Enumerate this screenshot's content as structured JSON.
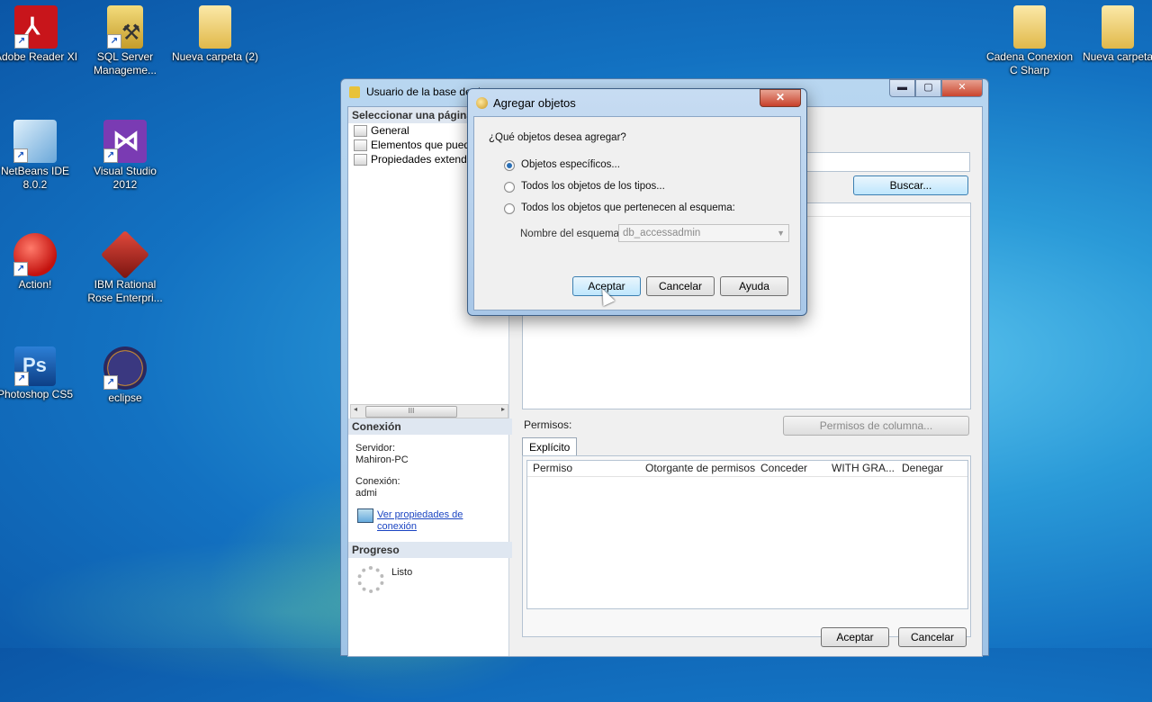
{
  "desktop": {
    "icons": [
      {
        "label1": "Adobe Reader XI",
        "label2": "",
        "icon": "adobe-reader-icon",
        "color": "#c8151b"
      },
      {
        "label1": "SQL Server",
        "label2": "Manageme...",
        "icon": "sql-server-icon",
        "color": "#d9b53a"
      },
      {
        "label1": "Nueva carpeta (2)",
        "label2": "",
        "icon": "folder-icon",
        "color": "#f1d27a"
      },
      {
        "label1": "NetBeans IDE",
        "label2": "8.0.2",
        "icon": "netbeans-icon",
        "color": "#7fb6e6"
      },
      {
        "label1": "Visual Studio",
        "label2": "2012",
        "icon": "visual-studio-icon",
        "color": "#7a3bb3"
      },
      {
        "label1": "Action!",
        "label2": "",
        "icon": "action-icon",
        "color": "#d42a22"
      },
      {
        "label1": "IBM Rational",
        "label2": "Rose Enterpri...",
        "icon": "ibm-rational-icon",
        "color": "#a8241c"
      },
      {
        "label1": "Photoshop CS5",
        "label2": "",
        "icon": "photoshop-icon",
        "color": "#1b64b8"
      },
      {
        "label1": "eclipse",
        "label2": "",
        "icon": "eclipse-icon",
        "color": "#2c2a6a"
      },
      {
        "label1": "Cadena Conexion",
        "label2": "C Sharp",
        "icon": "folder-icon",
        "color": "#f1d27a"
      },
      {
        "label1": "Nueva carpeta",
        "label2": "",
        "icon": "folder-icon",
        "color": "#f1d27a"
      }
    ]
  },
  "main_window": {
    "title": "Usuario de la base de d",
    "min": "▬",
    "max": "▢",
    "close": "✕",
    "left_header": "Seleccionar una página",
    "pages": [
      "General",
      "Elementos que pueden",
      "Propiedades extendida"
    ],
    "scroll_grip": "III",
    "conexion_header": "Conexión",
    "servidor_label": "Servidor:",
    "servidor_value": "Mahiron-PC",
    "conexion_label": "Conexión:",
    "conexion_value": "admi",
    "link_line1": "Ver propiedades de",
    "link_line2": "conexión",
    "progreso_header": "Progreso",
    "progreso_value": "Listo",
    "buscar_button": "Buscar...",
    "permisos_label": "Permisos:",
    "permisos_columna_button": "Permisos de columna...",
    "tab_explicito": "Explícito",
    "grid_columns": [
      "Permiso",
      "Otorgante de permisos",
      "Conceder",
      "WITH GRA...",
      "Denegar"
    ],
    "ok_button": "Aceptar",
    "cancel_button": "Cancelar"
  },
  "dialog": {
    "title": "Agregar objetos",
    "close": "✕",
    "question": "¿Qué objetos desea agregar?",
    "options": [
      "Objetos específicos...",
      "Todos los objetos de los tipos...",
      "Todos los objetos que pertenecen al esquema:"
    ],
    "selected_option": 0,
    "schema_label": "Nombre del esquema:",
    "schema_value": "db_accessadmin",
    "ok_button": "Aceptar",
    "cancel_button": "Cancelar",
    "help_button": "Ayuda"
  }
}
